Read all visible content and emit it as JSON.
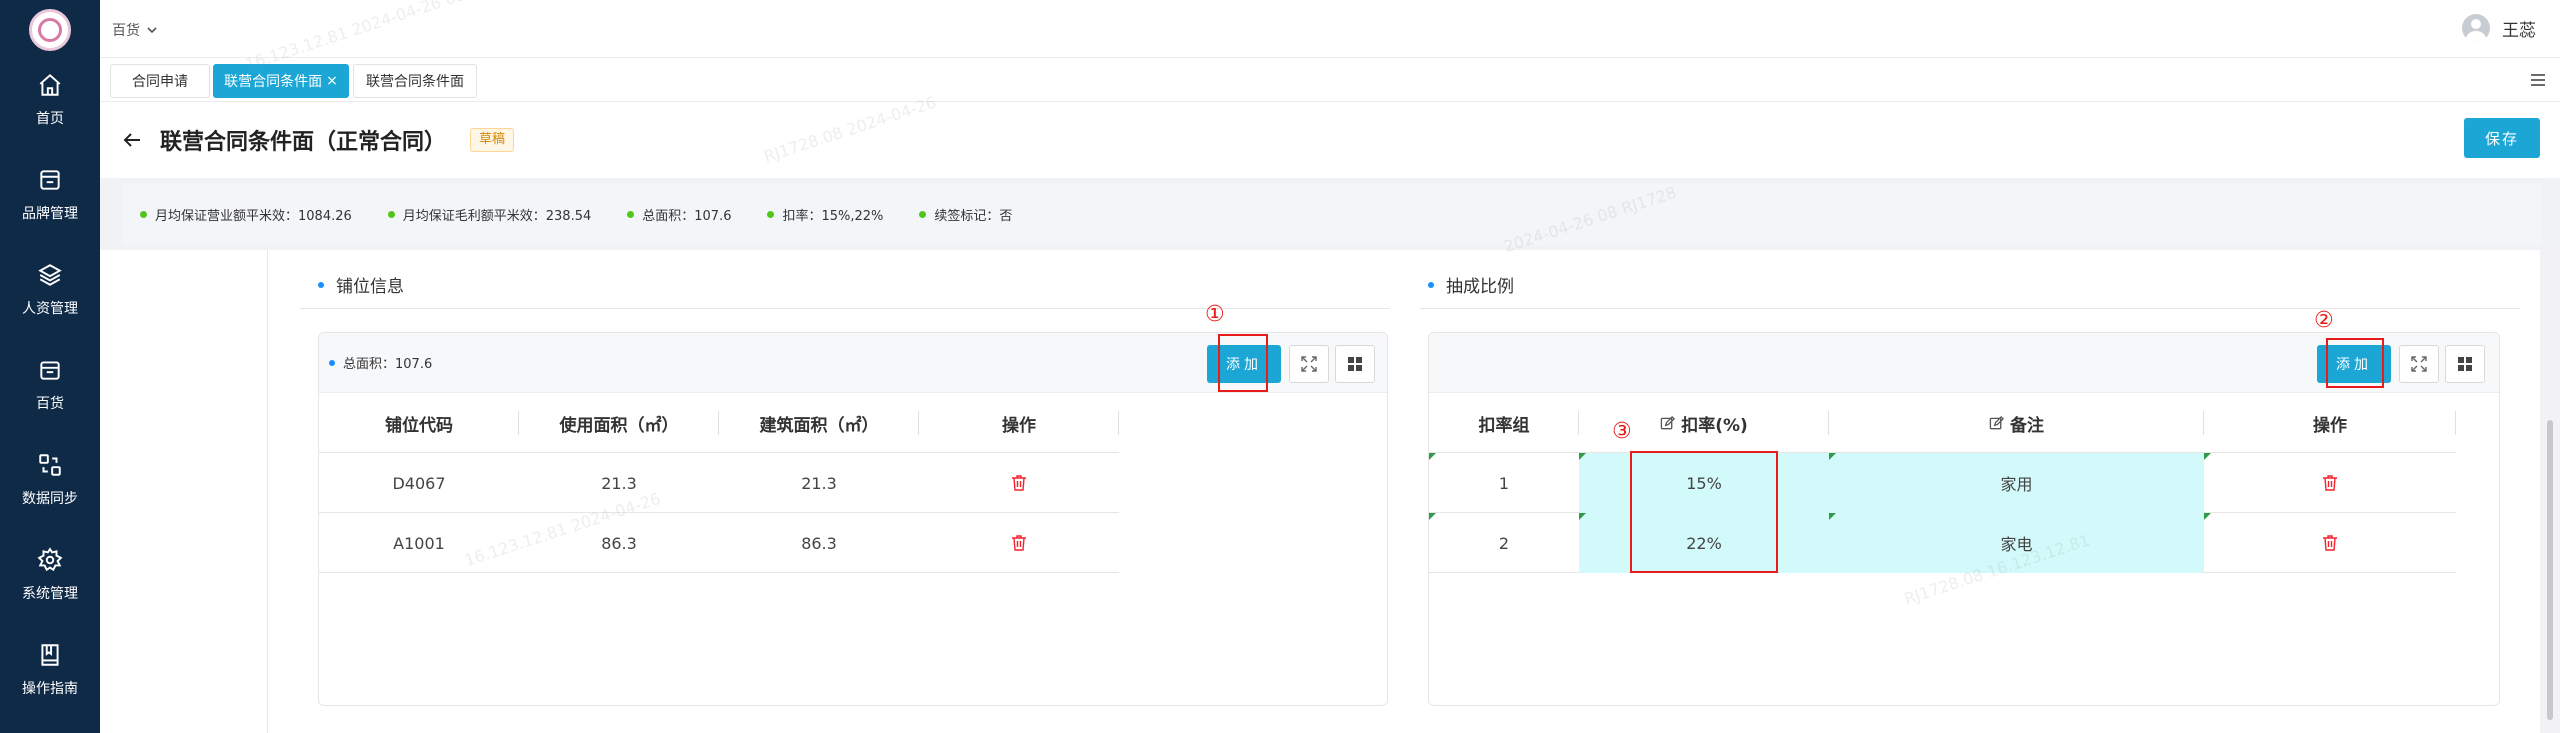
{
  "sidebar": {
    "items": [
      {
        "label": "首页",
        "icon": "home-icon"
      },
      {
        "label": "品牌管理",
        "icon": "storefront-icon"
      },
      {
        "label": "人资管理",
        "icon": "layers-icon"
      },
      {
        "label": "百货",
        "icon": "bag-icon"
      },
      {
        "label": "数据同步",
        "icon": "sync-icon"
      },
      {
        "label": "系统管理",
        "icon": "gear-icon"
      },
      {
        "label": "操作指南",
        "icon": "book-icon"
      }
    ]
  },
  "header": {
    "brand_select": "百货",
    "user_name": "王蕊"
  },
  "tabs": [
    {
      "label": "合同申请",
      "active": false
    },
    {
      "label": "联营合同条件面",
      "active": true
    },
    {
      "label": "联营合同条件面",
      "active": false
    }
  ],
  "page": {
    "title": "联营合同条件面（正常合同）",
    "status_badge": "草稿",
    "save_label": "保存"
  },
  "stats": [
    "月均保证营业额平米效：1084.26",
    "月均保证毛利额平米效：238.54",
    "总面积：107.6",
    "扣率：15%,22%",
    "续签标记：否"
  ],
  "shop_section": {
    "title": "铺位信息",
    "area_note": "总面积：107.6",
    "add_label": "添加",
    "columns": [
      "铺位代码",
      "使用面积（㎡）",
      "建筑面积（㎡）",
      "操作"
    ],
    "rows": [
      {
        "code": "D4067",
        "use_area": "21.3",
        "build_area": "21.3"
      },
      {
        "code": "A1001",
        "use_area": "86.3",
        "build_area": "86.3"
      }
    ]
  },
  "commission_section": {
    "title": "抽成比例",
    "add_label": "添加",
    "columns": [
      "扣率组",
      "扣率(%)",
      "备注",
      "操作"
    ],
    "rows": [
      {
        "group": "1",
        "rate": "15%",
        "note": "家用"
      },
      {
        "group": "2",
        "rate": "22%",
        "note": "家电"
      }
    ]
  },
  "annotations": {
    "one": "①",
    "two": "②",
    "three": "③"
  },
  "colors": {
    "sidebar_bg": "#0f2a47",
    "primary": "#1ba6d6",
    "editable_cell": "#d3fafa",
    "annotation_red": "#e81a1a",
    "delete_red": "#f5222d"
  }
}
